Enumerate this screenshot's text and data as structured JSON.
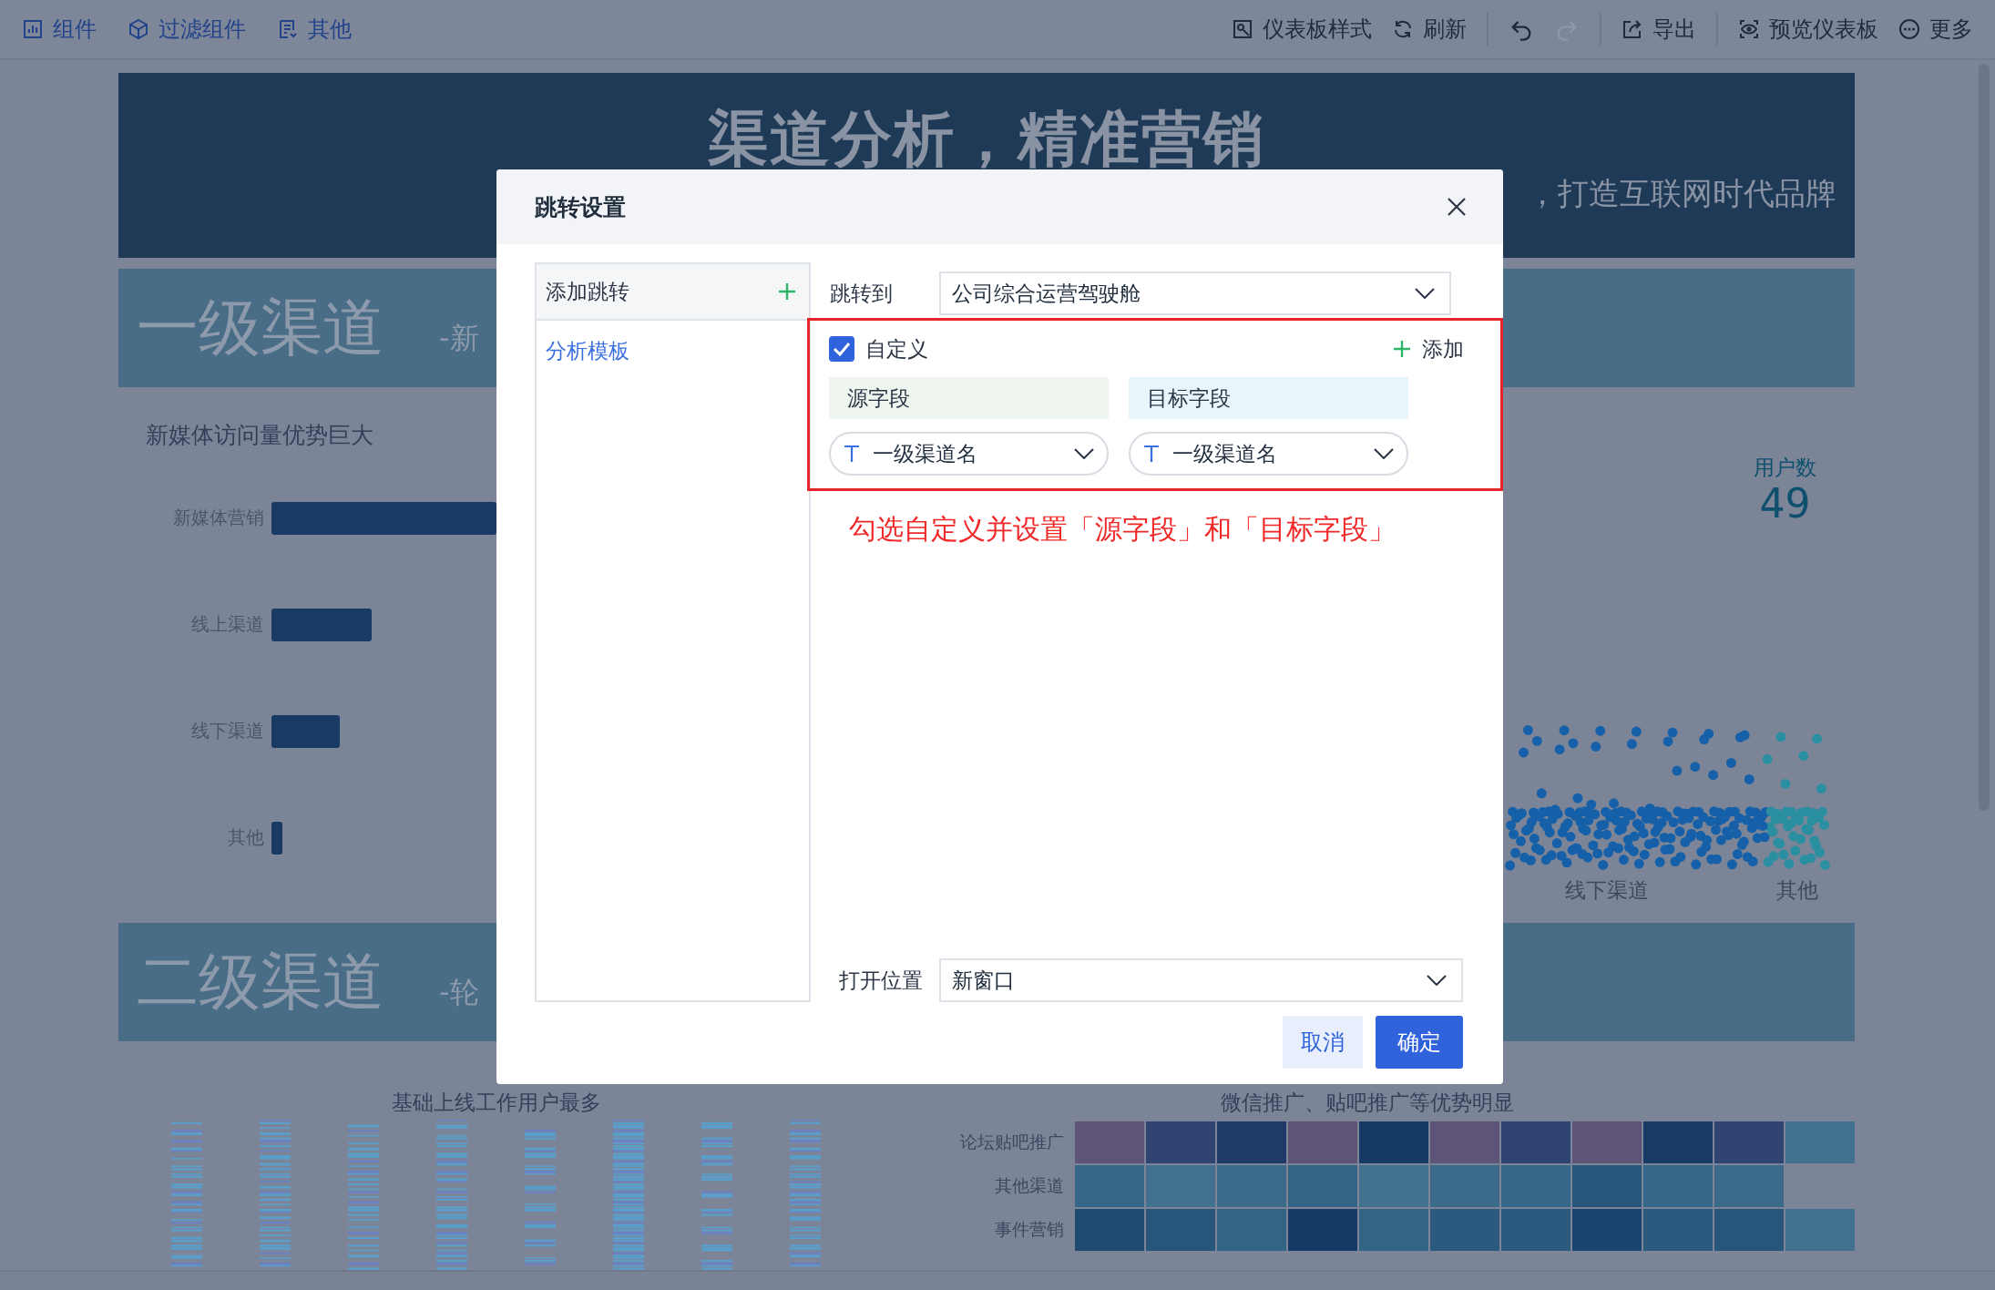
{
  "toolbar": {
    "left": [
      {
        "label": "组件"
      },
      {
        "label": "过滤组件"
      },
      {
        "label": "其他"
      }
    ],
    "right": [
      {
        "label": "仪表板样式"
      },
      {
        "label": "刷新"
      }
    ],
    "history": [
      {
        "kind": "undo",
        "disabled": false
      },
      {
        "kind": "redo",
        "disabled": true
      }
    ],
    "actions": [
      {
        "label": "导出"
      },
      {
        "label": "预览仪表板"
      },
      {
        "label": "更多"
      }
    ]
  },
  "dashboard": {
    "banner": {
      "title": "渠道分析，精准营销",
      "subtitle": "，打造互联网时代品牌"
    },
    "sections": [
      {
        "title": "一级渠道",
        "subtitle": "-新"
      },
      {
        "title": "二级渠道",
        "subtitle": "-轮"
      }
    ],
    "bar_chart": {
      "title": "新媒体访问量优势巨大",
      "categories": [
        "新媒体营销",
        "线上渠道",
        "线下渠道",
        "其他"
      ]
    },
    "metric": {
      "label": "用户数",
      "value": "49"
    },
    "scatter": {
      "labels": [
        "线下渠道",
        "其他"
      ]
    },
    "captions": [
      "基础上线工作用户最多",
      "微信推广、贴吧推广等优势明显"
    ],
    "heatmap": {
      "rows": [
        "论坛贴吧推广",
        "其他渠道",
        "事件营销"
      ]
    }
  },
  "dialog": {
    "title": "跳转设置",
    "left_panel": {
      "header": "添加跳转",
      "items": [
        {
          "label": "分析模板",
          "selected": true
        }
      ]
    },
    "jump_to": {
      "label": "跳转到",
      "value": "公司综合运营驾驶舱"
    },
    "custom": {
      "label": "自定义",
      "checked": true,
      "add_label": "添加",
      "source_header": "源字段",
      "target_header": "目标字段",
      "source_value": "一级渠道名",
      "target_value": "一级渠道名"
    },
    "note": "勾选自定义并设置「源字段」和「目标字段」",
    "open_position": {
      "label": "打开位置",
      "value": "新窗口"
    },
    "buttons": [
      {
        "label": "取消",
        "kind": "secondary"
      },
      {
        "label": "确定",
        "kind": "primary"
      }
    ]
  }
}
